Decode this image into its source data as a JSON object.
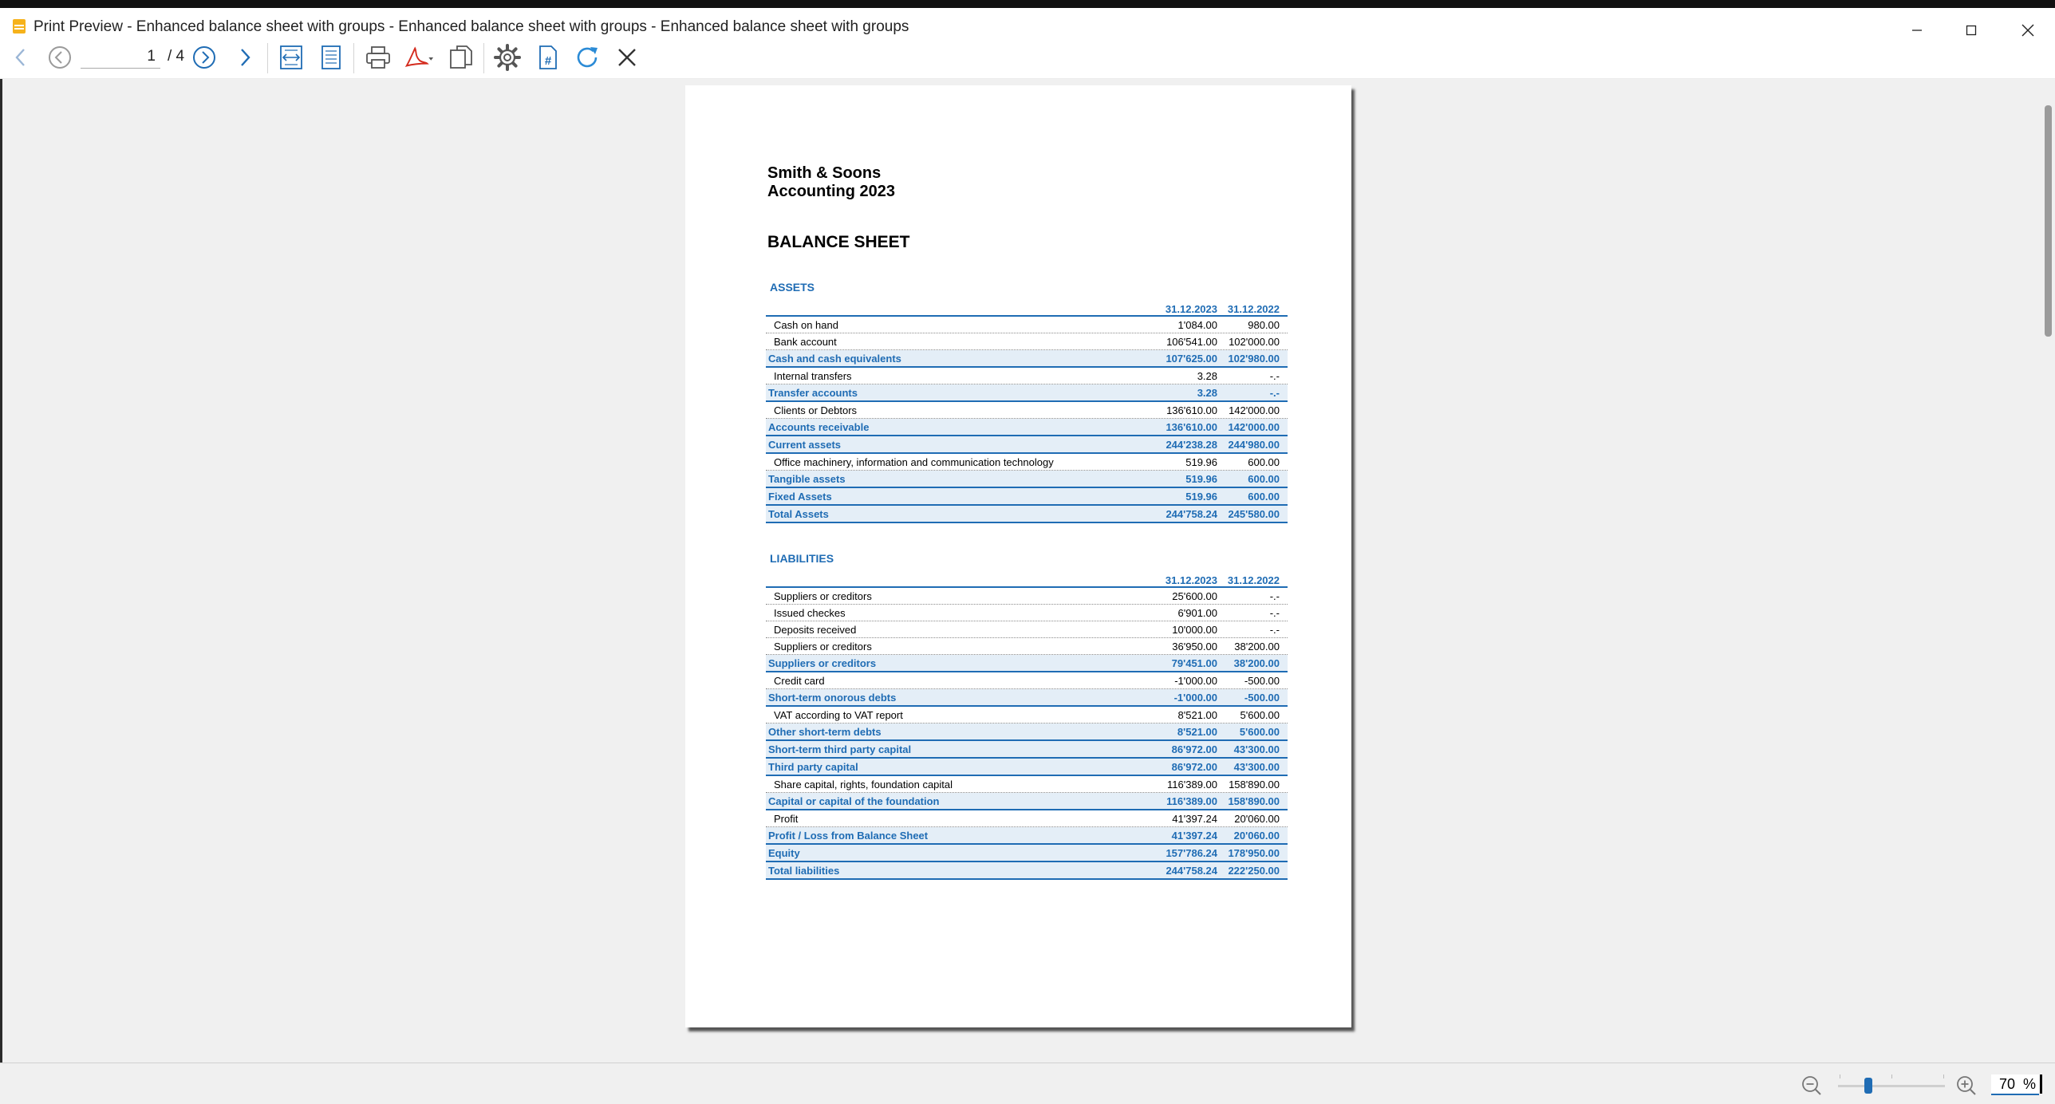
{
  "window": {
    "title": "Print Preview - Enhanced balance sheet with groups - Enhanced balance sheet with groups - Enhanced balance sheet with groups"
  },
  "toolbar": {
    "page_value": "1",
    "page_total": "/ 4"
  },
  "document": {
    "company": "Smith & Soons",
    "period": "Accounting 2023",
    "title": "BALANCE SHEET",
    "assets": {
      "title": "ASSETS",
      "col1": "31.12.2023",
      "col2": "31.12.2022",
      "rows": [
        {
          "desc": "Cash on hand",
          "v1": "1'084.00",
          "v2": "980.00",
          "group": false
        },
        {
          "desc": "Bank account",
          "v1": "106'541.00",
          "v2": "102'000.00",
          "group": false
        },
        {
          "desc": "Cash and cash equivalents",
          "v1": "107'625.00",
          "v2": "102'980.00",
          "group": true
        },
        {
          "desc": "Internal transfers",
          "v1": "3.28",
          "v2": "-.-",
          "group": false
        },
        {
          "desc": "Transfer accounts",
          "v1": "3.28",
          "v2": "-.-",
          "group": true
        },
        {
          "desc": "Clients or Debtors",
          "v1": "136'610.00",
          "v2": "142'000.00",
          "group": false
        },
        {
          "desc": "Accounts receivable",
          "v1": "136'610.00",
          "v2": "142'000.00",
          "group": true
        },
        {
          "desc": "Current assets",
          "v1": "244'238.28",
          "v2": "244'980.00",
          "group": true
        },
        {
          "desc": "Office machinery, information and communication technology",
          "v1": "519.96",
          "v2": "600.00",
          "group": false
        },
        {
          "desc": "Tangible assets",
          "v1": "519.96",
          "v2": "600.00",
          "group": true
        },
        {
          "desc": "Fixed Assets",
          "v1": "519.96",
          "v2": "600.00",
          "group": true
        },
        {
          "desc": "Total Assets",
          "v1": "244'758.24",
          "v2": "245'580.00",
          "group": true
        }
      ]
    },
    "liabilities": {
      "title": "LIABILITIES",
      "col1": "31.12.2023",
      "col2": "31.12.2022",
      "rows": [
        {
          "desc": "Suppliers or creditors",
          "v1": "25'600.00",
          "v2": "-.-",
          "group": false
        },
        {
          "desc": "Issued checkes",
          "v1": "6'901.00",
          "v2": "-.-",
          "group": false
        },
        {
          "desc": "Deposits received",
          "v1": "10'000.00",
          "v2": "-.-",
          "group": false
        },
        {
          "desc": "Suppliers or creditors",
          "v1": "36'950.00",
          "v2": "38'200.00",
          "group": false
        },
        {
          "desc": "Suppliers or creditors",
          "v1": "79'451.00",
          "v2": "38'200.00",
          "group": true
        },
        {
          "desc": "Credit card",
          "v1": "-1'000.00",
          "v2": "-500.00",
          "group": false
        },
        {
          "desc": "Short-term onorous debts",
          "v1": "-1'000.00",
          "v2": "-500.00",
          "group": true
        },
        {
          "desc": "VAT according to VAT report",
          "v1": "8'521.00",
          "v2": "5'600.00",
          "group": false
        },
        {
          "desc": "Other short-term debts",
          "v1": "8'521.00",
          "v2": "5'600.00",
          "group": true
        },
        {
          "desc": "Short-term third party capital",
          "v1": "86'972.00",
          "v2": "43'300.00",
          "group": true
        },
        {
          "desc": "Third party capital",
          "v1": "86'972.00",
          "v2": "43'300.00",
          "group": true
        },
        {
          "desc": "Share capital, rights, foundation capital",
          "v1": "116'389.00",
          "v2": "158'890.00",
          "group": false
        },
        {
          "desc": "Capital or capital of the foundation",
          "v1": "116'389.00",
          "v2": "158'890.00",
          "group": true
        },
        {
          "desc": "Profit",
          "v1": "41'397.24",
          "v2": "20'060.00",
          "group": false
        },
        {
          "desc": "Profit / Loss from Balance Sheet",
          "v1": "41'397.24",
          "v2": "20'060.00",
          "group": true
        },
        {
          "desc": "Equity",
          "v1": "157'786.24",
          "v2": "178'950.00",
          "group": true
        },
        {
          "desc": "Total liabilities",
          "v1": "244'758.24",
          "v2": "222'250.00",
          "group": true
        }
      ]
    }
  },
  "status": {
    "zoom_value": "70  %",
    "zoom_level": 0.28
  },
  "colors": {
    "accent": "#1f6cb4",
    "group_bg": "#e4eef7"
  }
}
